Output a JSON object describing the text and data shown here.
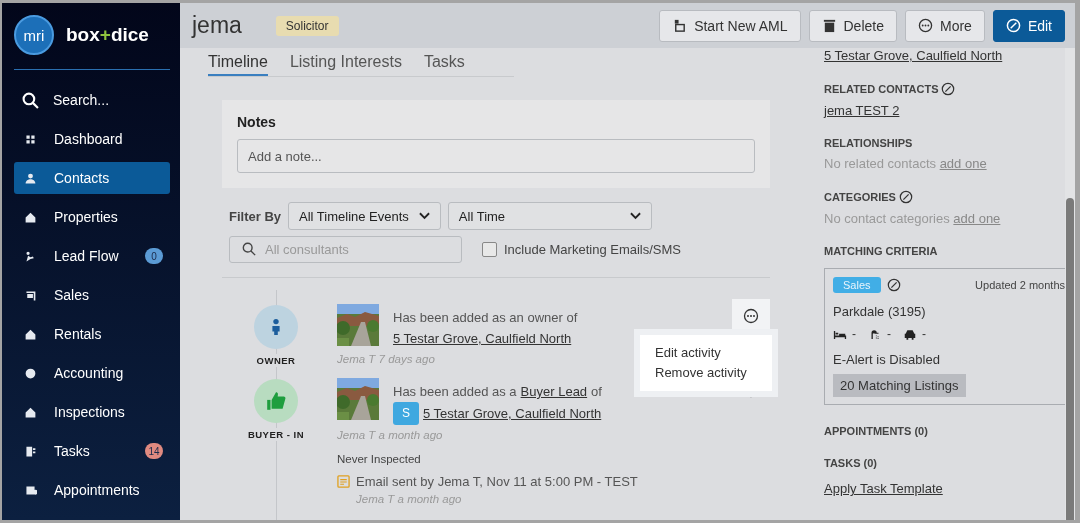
{
  "brand": {
    "logo": "mri",
    "name": [
      "box",
      "+",
      "dice"
    ]
  },
  "sidebar": {
    "search": "Search...",
    "items": [
      {
        "label": "Dashboard",
        "selected": false
      },
      {
        "label": "Contacts",
        "selected": true
      },
      {
        "label": "Properties",
        "selected": false
      },
      {
        "label": "Lead Flow",
        "selected": false,
        "badge": "0",
        "color": "#5b9bd5"
      },
      {
        "label": "Sales",
        "selected": false
      },
      {
        "label": "Rentals",
        "selected": false
      },
      {
        "label": "Accounting",
        "selected": false
      },
      {
        "label": "Inspections",
        "selected": false
      },
      {
        "label": "Tasks",
        "selected": false,
        "badge": "14",
        "color": "#e08a80"
      },
      {
        "label": "Appointments",
        "selected": false
      }
    ]
  },
  "header": {
    "name": "jema",
    "tag": "Solicitor",
    "buttons": [
      {
        "label": "Start New AML",
        "primary": false
      },
      {
        "label": "Delete",
        "primary": false
      },
      {
        "label": "More",
        "primary": false
      },
      {
        "label": "Edit",
        "primary": true
      }
    ]
  },
  "tabs": [
    {
      "label": "Timeline",
      "selected": true
    },
    {
      "label": "Listing Interests",
      "selected": false
    },
    {
      "label": "Tasks",
      "selected": false
    }
  ],
  "notes": {
    "title": "Notes",
    "placeholder": "Add a note..."
  },
  "filter": {
    "label": "Filter By",
    "selects": [
      "All Timeline Events",
      "All Time"
    ],
    "consultants_placeholder": "All consultants",
    "checkbox": {
      "label": "Include Marketing Emails/SMS",
      "checked": false
    }
  },
  "timeline": [
    {
      "kind": "owner",
      "badge": "OWNER",
      "text": "Has been added as an owner of",
      "link": "5 Testar Grove, Caulfield North",
      "meta": "Jema T 7 days ago"
    },
    {
      "kind": "buyer",
      "badge": "BUYER - IN",
      "text": "Has been added as a ",
      "text_link": "Buyer Lead",
      "text_after": " of",
      "tag": "S",
      "link": "5 Testar Grove, Caulfield North",
      "meta": "Jema T a month ago",
      "note": "Never Inspected",
      "email": "Email sent by Jema T, Nov 11 at  5:00 PM - TEST",
      "email_meta": "Jema T a month ago"
    }
  ],
  "activity_menu": [
    "Edit activity",
    "Remove activity"
  ],
  "details": {
    "address_link": "5 Testar Grove, Caulfield North",
    "related_contacts": {
      "title": "RELATED CONTACTS",
      "link": "jema TEST 2"
    },
    "relationships": {
      "title": "RELATIONSHIPS",
      "empty": "No related contacts",
      "action": "add one"
    },
    "categories": {
      "title": "CATEGORIES",
      "empty": "No contact categories",
      "action": "add one"
    },
    "matching": {
      "title": "MATCHING CRITERIA",
      "tag": "Sales",
      "updated": "Updated 2 months",
      "location": "Parkdale (3195)",
      "features": [
        "-",
        "-",
        "-"
      ],
      "alert": "E-Alert is Disabled",
      "listings": "20 Matching Listings"
    },
    "appointments": "APPOINTMENTS (0)",
    "tasks": "TASKS (0)",
    "template_link": "Apply Task Template"
  }
}
